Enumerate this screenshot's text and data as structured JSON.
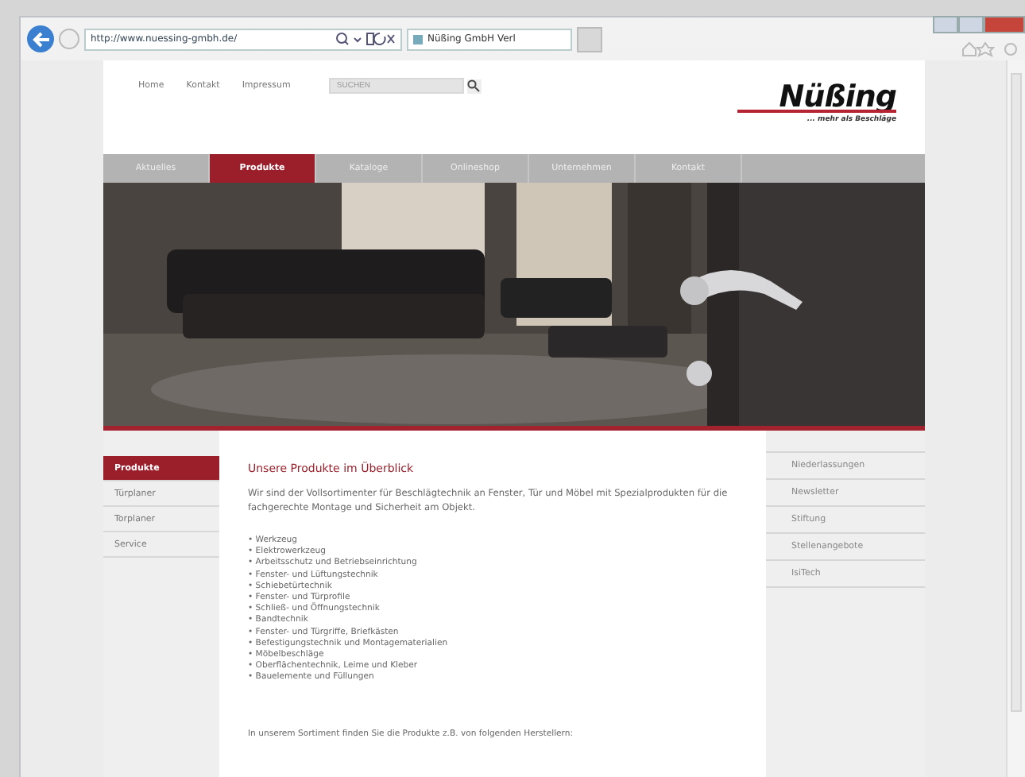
{
  "browser": {
    "address": "http://www.nuessing-gmbh.de/",
    "tab_title": "Nüßing GmbH Verl"
  },
  "header": {
    "links": [
      "Home",
      "Kontakt",
      "Impressum"
    ],
    "search": {
      "placeholder": "SUCHEN"
    },
    "logo": "Nüßing",
    "slogan": "... mehr als Beschläge"
  },
  "nav": [
    {
      "label": "Aktuelles",
      "selected": false
    },
    {
      "label": "Produkte",
      "selected": true
    },
    {
      "label": "Kataloge",
      "selected": false
    },
    {
      "label": "Onlineshop",
      "selected": false
    },
    {
      "label": "Unternehmen",
      "selected": false
    },
    {
      "label": "Kontakt",
      "selected": false
    }
  ],
  "hero": {
    "kind": "picture"
  },
  "left_menu": [
    {
      "label": "Produkte",
      "selected": true
    },
    {
      "label": "Türplaner",
      "selected": false
    },
    {
      "label": "Torplaner",
      "selected": false
    },
    {
      "label": "Service",
      "selected": false
    }
  ],
  "content": {
    "heading": "Unsere Produkte im Überblick",
    "intro": "Wir sind der Vollsortimenter für Beschlägtechnik an Fenster, Tür und Möbel mit Spezialprodukten für die fachgerechte Montage und Sicherheit am Objekt.",
    "items": [
      "• Werkzeug",
      "• Elektrowerkzeug",
      "• Arbeitsschutz und Betriebseinrichtung",
      "• Fenster- und Lüftungstechnik",
      "• Schiebetürtechnik",
      "• Fenster- und Türprofile",
      "• Schließ- und Öffnungstechnik",
      "• Bandtechnik",
      "• Fenster- und Türgriffe, Briefkästen",
      "• Befestigungstechnik und Montagematerialien",
      "• Möbelbeschläge",
      "• Oberflächentechnik, Leime und Kleber",
      "• Bauelemente und Füllungen"
    ],
    "footer_text": "In unserem Sortiment finden Sie die Produkte z.B. von folgenden Herstellern:"
  },
  "right_menu": [
    "Niederlassungen",
    "Newsletter",
    "Stiftung",
    "Stellenangebote",
    "IsiTech"
  ]
}
